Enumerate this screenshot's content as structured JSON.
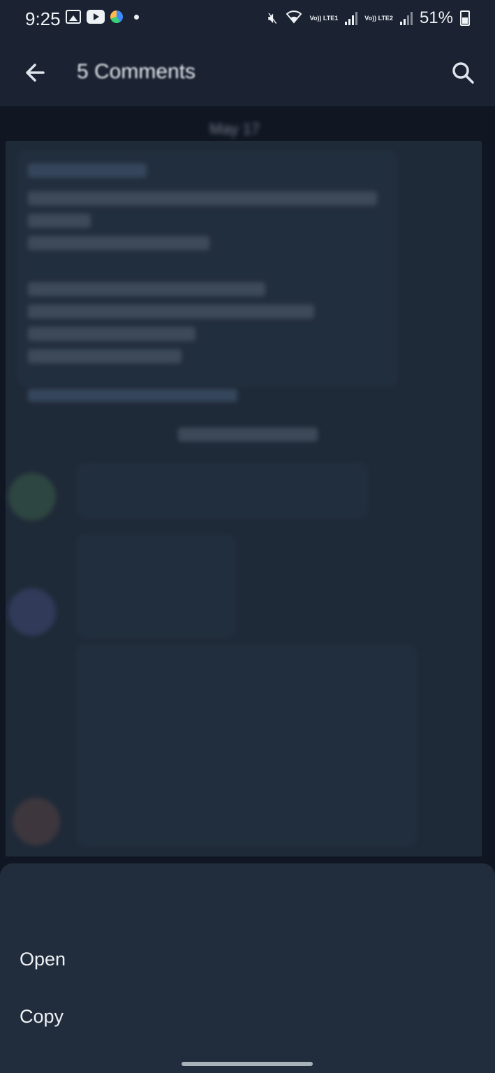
{
  "status_bar": {
    "time": "9:25",
    "battery": "51%",
    "lte1": "Vo)) LTE1",
    "lte2": "Vo)) LTE2"
  },
  "app_bar": {
    "title": "5 Comments",
    "back_icon": "arrow-back-icon",
    "search_icon": "search-icon"
  },
  "chat": {
    "date": "May 17"
  },
  "sheet": {
    "items": [
      {
        "label": "Open"
      },
      {
        "label": "Copy"
      }
    ]
  },
  "colors": {
    "app_bar_bg": "#1b2332",
    "chat_bg": "#101723",
    "sheet_bg": "#212d3d",
    "text": "#eef1f4"
  }
}
